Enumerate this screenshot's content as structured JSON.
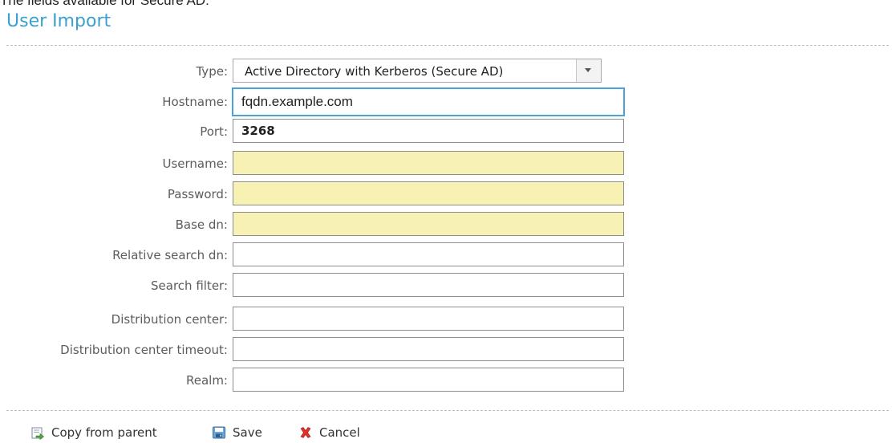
{
  "caption": "The fields available for Secure AD:",
  "title": "User Import",
  "form": {
    "type": {
      "label": "Type:",
      "value": "Active Directory with Kerberos (Secure AD)"
    },
    "hostname": {
      "label": "Hostname:",
      "value": "fqdn.example.com"
    },
    "port": {
      "label": "Port:",
      "value": "3268"
    },
    "username": {
      "label": "Username:",
      "value": ""
    },
    "password": {
      "label": "Password:",
      "value": ""
    },
    "base_dn": {
      "label": "Base dn:",
      "value": ""
    },
    "relative_search_dn": {
      "label": "Relative search dn:",
      "value": ""
    },
    "search_filter": {
      "label": "Search filter:",
      "value": ""
    },
    "distribution_center": {
      "label": "Distribution center:",
      "value": ""
    },
    "distribution_center_timeout": {
      "label": "Distribution center timeout:",
      "value": ""
    },
    "realm": {
      "label": "Realm:",
      "value": ""
    }
  },
  "actions": {
    "copy_from_parent": "Copy from parent",
    "save": "Save",
    "cancel": "Cancel"
  },
  "colors": {
    "title": "#3aa0cf",
    "required_field": "#f7f2b3",
    "focus_border": "#4aa3d8"
  },
  "icons": {
    "copy": "copy-from-parent-icon",
    "save": "save-icon",
    "cancel": "cancel-icon"
  }
}
